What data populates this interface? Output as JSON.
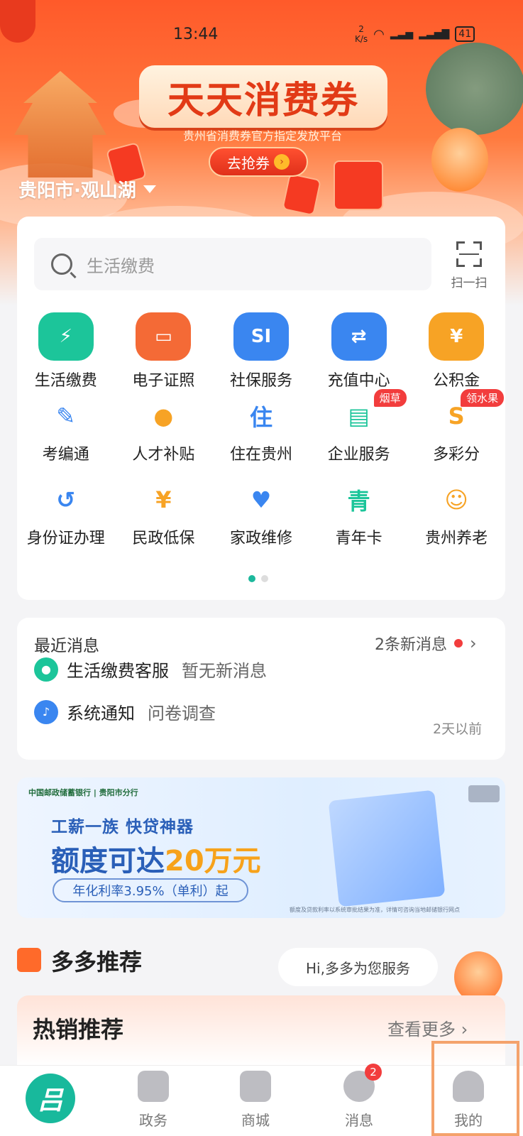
{
  "status": {
    "time": "13:44",
    "speed_value": "2",
    "speed_unit": "K/s",
    "battery": "41"
  },
  "banner": {
    "title": "天天消费券",
    "subtitle": "贵州省消费券官方指定发放平台",
    "cta": "去抢券",
    "location": "贵阳市·观山湖"
  },
  "search": {
    "placeholder": "生活缴费"
  },
  "scan": {
    "label": "扫一扫"
  },
  "services": [
    {
      "label": "生活缴费",
      "icon": "bolt-drop-icon",
      "color": "#1cc59a",
      "glyph": "⚡"
    },
    {
      "label": "电子证照",
      "icon": "id-card-icon",
      "color": "#f46a36",
      "glyph": "▭"
    },
    {
      "label": "社保服务",
      "icon": "si-icon",
      "color": "#3a86f0",
      "glyph": "SI"
    },
    {
      "label": "充值中心",
      "icon": "phone-recharge-icon",
      "color": "#3a86f0",
      "glyph": "⇄"
    },
    {
      "label": "公积金",
      "icon": "house-yen-icon",
      "color": "#f7a325",
      "glyph": "¥"
    },
    {
      "label": "考编通",
      "icon": "doc-edit-icon",
      "color": "#3a86f0",
      "glyph": "✎",
      "badge": ""
    },
    {
      "label": "人才补贴",
      "icon": "doc-coin-icon",
      "color": "#f7a325",
      "glyph": "●",
      "badge": ""
    },
    {
      "label": "住在贵州",
      "icon": "doc-home-icon",
      "color": "#3a86f0",
      "glyph": "住",
      "badge": ""
    },
    {
      "label": "企业服务",
      "icon": "briefcase-icon",
      "color": "#1cc59a",
      "glyph": "▤",
      "badge": "烟草"
    },
    {
      "label": "多彩分",
      "icon": "laurel-coin-icon",
      "color": "#f7a325",
      "glyph": "S",
      "badge": "领水果"
    },
    {
      "label": "身份证办理",
      "icon": "doc-refresh-icon",
      "color": "#3a86f0",
      "glyph": "↺"
    },
    {
      "label": "民政低保",
      "icon": "person-yen-icon",
      "color": "#f7a325",
      "glyph": "¥"
    },
    {
      "label": "家政维修",
      "icon": "house-heart-icon",
      "color": "#3a86f0",
      "glyph": "♥"
    },
    {
      "label": "青年卡",
      "icon": "youth-card-icon",
      "color": "#1cc59a",
      "glyph": "青"
    },
    {
      "label": "贵州养老",
      "icon": "elderly-icon",
      "color": "#f7a325",
      "glyph": "☺"
    }
  ],
  "messages": {
    "title": "最近消息",
    "new_count": "2条新消息",
    "items": [
      {
        "name": "生活缴费客服",
        "sub": "暂无新消息",
        "time": ""
      },
      {
        "name": "系统通知",
        "sub": "问卷调查",
        "time": "2天以前"
      }
    ]
  },
  "ad": {
    "bank": "中国邮政储蓄银行 | 贵阳市分行",
    "line1": "工薪一族  快贷神器",
    "line2_a": "额度可达",
    "line2_b": "20万元",
    "pill": "年化利率3.95%（单利）起",
    "note": "额度及贷款利率以系统审批结果为准，详情可咨询当地邮储银行网点"
  },
  "recommend": {
    "title": "多多推荐",
    "bubble": "Hi,多多为您服务",
    "hot_title": "热销推荐",
    "hot_more": "查看更多 ›"
  },
  "tabs": [
    {
      "label": "",
      "icon": "home-logo-icon"
    },
    {
      "label": "政务",
      "icon": "gov-icon"
    },
    {
      "label": "商城",
      "icon": "shop-icon"
    },
    {
      "label": "消息",
      "icon": "chat-icon",
      "badge": "2"
    },
    {
      "label": "我的",
      "icon": "user-icon"
    }
  ],
  "colors": {
    "accent": "#18b99c",
    "banner": "#ff5a2a",
    "badge": "#f23d3d",
    "link": "#2a5fb8"
  }
}
